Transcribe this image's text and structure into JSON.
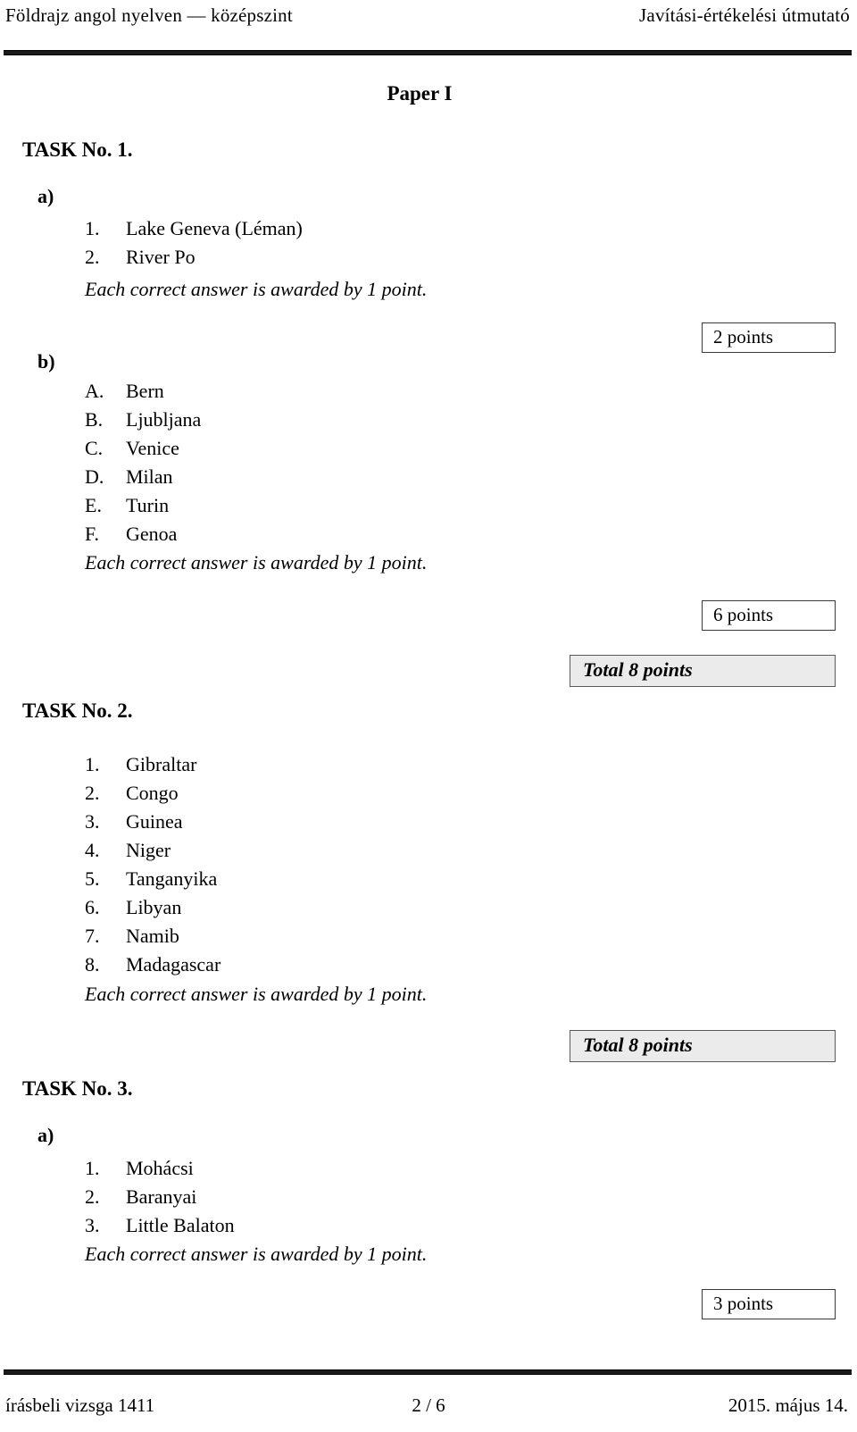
{
  "header": {
    "left": "Földrajz angol nyelven — középszint",
    "right": "Javítási-értékelési útmutató"
  },
  "paper_title": "Paper I",
  "tasks": [
    {
      "heading": "TASK No. 1.",
      "parts": [
        {
          "label": "a)",
          "items": [
            {
              "marker": "1.",
              "text": "Lake Geneva (Léman)"
            },
            {
              "marker": "2.",
              "text": "River Po"
            }
          ],
          "note": "Each correct answer is awarded by 1 point.",
          "points": "2 points"
        },
        {
          "label": "b)",
          "items": [
            {
              "marker": "A.",
              "text": "Bern"
            },
            {
              "marker": "B.",
              "text": "Ljubljana"
            },
            {
              "marker": "C.",
              "text": "Venice"
            },
            {
              "marker": "D.",
              "text": "Milan"
            },
            {
              "marker": "E.",
              "text": "Turin"
            },
            {
              "marker": "F.",
              "text": "Genoa"
            }
          ],
          "note": "Each correct answer is awarded by 1 point.",
          "points": "6 points"
        }
      ],
      "total": "Total 8 points"
    },
    {
      "heading": "TASK No. 2.",
      "parts": [
        {
          "label": "",
          "items": [
            {
              "marker": "1.",
              "text": "Gibraltar"
            },
            {
              "marker": "2.",
              "text": "Congo"
            },
            {
              "marker": "3.",
              "text": "Guinea"
            },
            {
              "marker": "4.",
              "text": "Niger"
            },
            {
              "marker": "5.",
              "text": "Tanganyika"
            },
            {
              "marker": "6.",
              "text": "Libyan"
            },
            {
              "marker": "7.",
              "text": "Namib"
            },
            {
              "marker": "8.",
              "text": "Madagascar"
            }
          ],
          "note": "Each correct answer is awarded by 1 point.",
          "points": ""
        }
      ],
      "total": "Total 8 points"
    },
    {
      "heading": "TASK No. 3.",
      "parts": [
        {
          "label": "a)",
          "items": [
            {
              "marker": "1.",
              "text": "Mohácsi"
            },
            {
              "marker": "2.",
              "text": "Baranyai"
            },
            {
              "marker": "3.",
              "text": "Little Balaton"
            }
          ],
          "note": "Each correct answer is awarded by 1 point.",
          "points": "3 points"
        }
      ],
      "total": ""
    }
  ],
  "footer": {
    "left": "írásbeli vizsga 1411",
    "center": "2 / 6",
    "right": "2015. május 14."
  }
}
